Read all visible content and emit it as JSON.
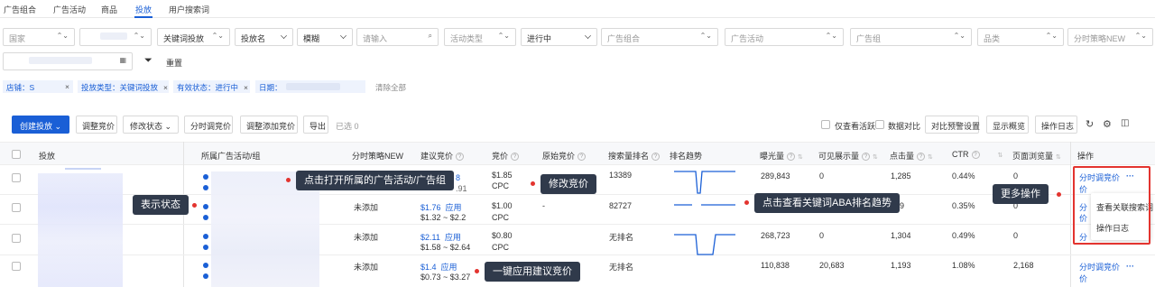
{
  "tabs": [
    {
      "label": "广告组合"
    },
    {
      "label": "广告活动"
    },
    {
      "label": "商品"
    },
    {
      "label": "投放"
    },
    {
      "label": "用户搜索词"
    }
  ],
  "filters": {
    "country": "国家",
    "ad_type": "关键词投放",
    "target_name": "投放名",
    "match": "模糊",
    "search_placeholder": "请输入",
    "activity_type": "活动类型",
    "status": "进行中",
    "portfolio": "广告组合",
    "campaign": "广告活动",
    "adgroup": "广告组",
    "category": "品类",
    "strategy": "分时策略NEW",
    "reset": "重置"
  },
  "chips": [
    {
      "label": "店铺：S"
    },
    {
      "label": "投放类型：关键词投放"
    },
    {
      "label": "有效状态：进行中"
    },
    {
      "label": "日期："
    }
  ],
  "clear_all": "清除全部",
  "toolbar": {
    "create": "创建投放",
    "adjust_bid": "调整竞价",
    "change_status": "修改状态",
    "timed_bid": "分时调竞价",
    "adjust_rec_bid": "调整添加竞价",
    "export": "导出",
    "selected": "已选 0",
    "only_active": "仅查看活跃",
    "compare": "数据对比",
    "alert_settings": "对比预警设置",
    "display_overview": "显示概览",
    "op_log": "操作日志"
  },
  "columns": {
    "target": "投放",
    "campaign": "所属广告活动/组",
    "strategy": "分时策略NEW",
    "suggest": "建议竞价",
    "bid": "竞价",
    "orig_bid": "原始竞价",
    "rank": "搜索量排名",
    "trend": "排名趋势",
    "impressions": "曝光量",
    "visible_imp": "可见展示量",
    "clicks": "点击量",
    "ctr": "CTR",
    "top_imp": "页面浏览量",
    "ops": "操作"
  },
  "rows": [
    {
      "strategy": "",
      "suggest_val": "",
      "suggest_apply": "",
      "suggest_range": "",
      "suffix_top": "8",
      "suffix_bot": ".91",
      "bid": "$1.85",
      "bid_unit": "CPC",
      "orig": "",
      "rank": "13389",
      "impressions": "289,843",
      "visible": "0",
      "clicks": "1,285",
      "ctr": "0.44%",
      "top": "0",
      "op_link": "分时调竞价"
    },
    {
      "strategy": "未添加",
      "suggest_val": "$1.76",
      "suggest_apply": "应用",
      "suggest_range": "$1.32 ~ $2.2",
      "bid": "$1.00",
      "bid_unit": "CPC",
      "orig": "-",
      "rank": "82727",
      "impressions": "",
      "visible": "",
      "clicks": "429",
      "ctr": "0.35%",
      "top": "0",
      "op_link": "分时调竞价"
    },
    {
      "strategy": "未添加",
      "suggest_val": "$2.11",
      "suggest_apply": "应用",
      "suggest_range": "$1.58 ~ $2.64",
      "bid": "$0.80",
      "bid_unit": "CPC",
      "orig": "",
      "rank": "无排名",
      "impressions": "268,723",
      "visible": "0",
      "clicks": "1,304",
      "ctr": "0.49%",
      "top": "0",
      "op_link": "分时调竞价"
    },
    {
      "strategy": "未添加",
      "suggest_val": "$1.4",
      "suggest_apply": "应用",
      "suggest_range": "$0.73 ~ $3.27",
      "bid": "",
      "bid_unit": "",
      "orig": "",
      "rank": "无排名",
      "impressions": "110,838",
      "visible": "20,683",
      "clicks": "1,193",
      "ctr": "1.08%",
      "top": "2,168",
      "op_link": "分时调竞价"
    }
  ],
  "ops_menu": [
    "查看关联搜索词",
    "操作日志"
  ],
  "callouts": {
    "open_campaign": "点击打开所属的广告活动/广告组",
    "edit_bid": "修改竞价",
    "status": "表示状态",
    "aba_trend": "点击查看关键词ABA排名趋势",
    "more_ops": "更多操作",
    "apply_suggest": "一键应用建议竞价"
  },
  "colors": {
    "accent": "#1a5fd6",
    "callout_bg": "#303a4b",
    "highlight": "#e3342f"
  }
}
